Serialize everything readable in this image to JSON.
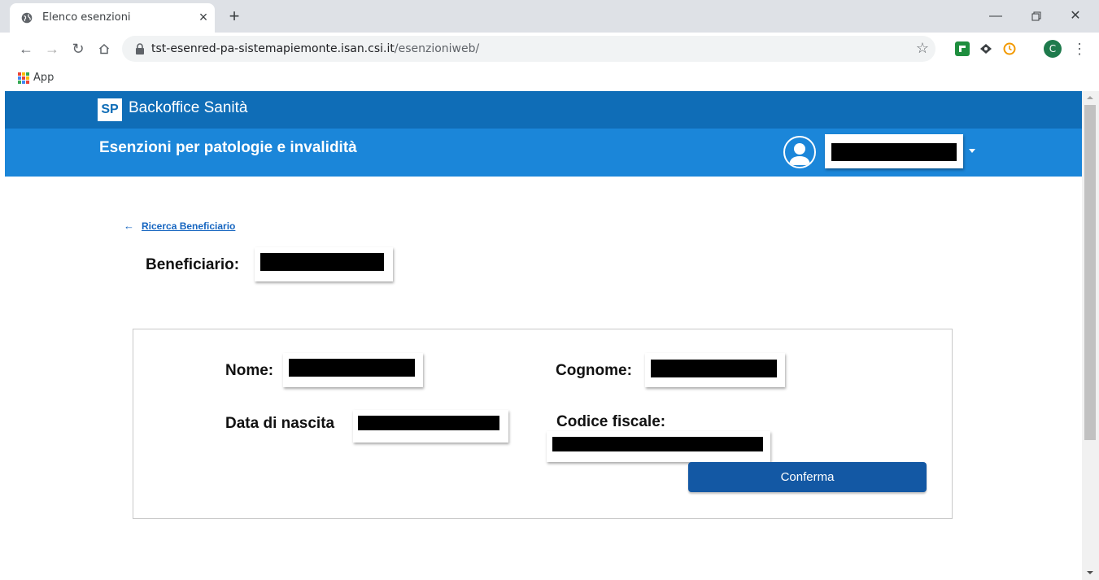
{
  "browser": {
    "tab_title": "Elenco esenzioni",
    "url_host": "tst-esenred-pa-sistemapiemonte.isan.csi.it",
    "url_path": "/esenzioniweb/",
    "profile_initial": "C",
    "bookmarks_apps_label": "App",
    "icons": [
      "globe-icon",
      "close-icon",
      "plus-icon",
      "minimize-icon",
      "restore-icon",
      "window-close-icon",
      "back-icon",
      "forward-icon",
      "reload-icon",
      "home-icon",
      "lock-icon",
      "star-icon",
      "menu-icon",
      "apps-icon"
    ]
  },
  "header": {
    "logo_text": "SP",
    "brand_title": "Backoffice Sanità",
    "app_title": "Esenzioni per patologie e invalidità"
  },
  "page": {
    "back_arrow": "←",
    "back_link_label": "Ricerca Beneficiario",
    "beneficiario_label": "Beneficiario:"
  },
  "card": {
    "nome_label": "Nome:",
    "cognome_label": "Cognome:",
    "data_nascita_label": "Data di nascita",
    "codice_fiscale_label": "Codice fiscale:",
    "confirm_label": "Conferma"
  },
  "colors": {
    "brand_bar": "#0f6db7",
    "app_bar": "#1b86d9",
    "link": "#1565c0",
    "button": "#1358a4"
  }
}
